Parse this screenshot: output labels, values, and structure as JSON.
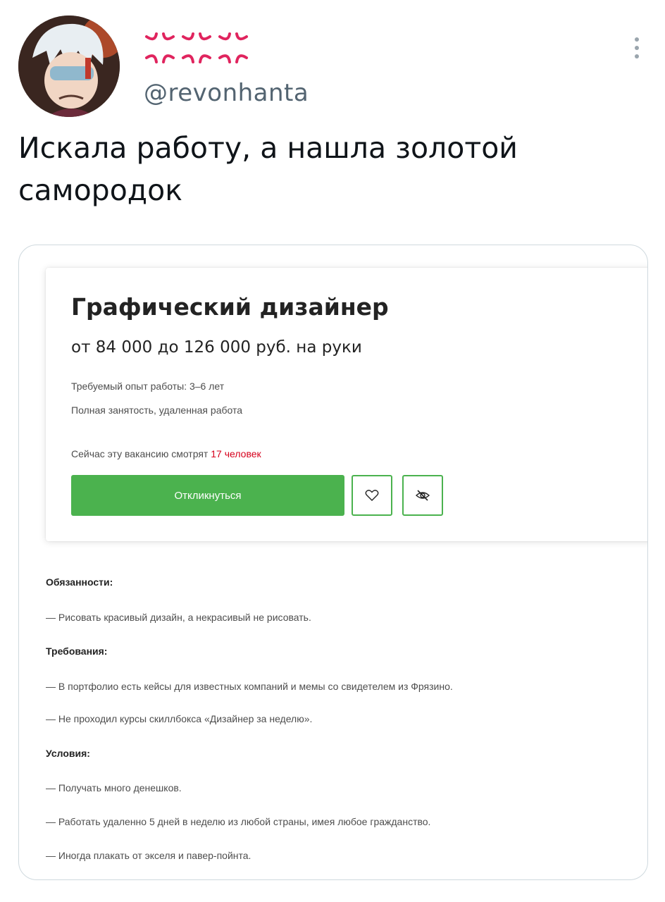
{
  "tweet": {
    "display_name_icons": [
      "anger-icon",
      "anger-icon",
      "anger-icon"
    ],
    "handle": "@revonhanta",
    "text": "Искала работу, а нашла золотой самородок"
  },
  "vacancy": {
    "title": "Графический дизайнер",
    "salary": "от 84 000 до 126 000 руб. на руки",
    "experience": "Требуемый опыт работы: 3–6 лет",
    "employment": "Полная занятость, удаленная работа",
    "viewers_prefix": "Сейчас эту вакансию смотрят ",
    "viewers_count": "17 человек",
    "apply_label": "Откликнуться",
    "accent_color": "#4bb24e"
  },
  "description": {
    "duties_heading": "Обязанности:",
    "duties": [
      "— Рисовать красивый дизайн, а некрасивый не рисовать."
    ],
    "requirements_heading": "Требования:",
    "requirements": [
      "— В портфолио есть кейсы для известных компаний и мемы со свидетелем из Фрязино.",
      "— Не проходил курсы скиллбокса «Дизайнер за неделю»."
    ],
    "conditions_heading": "Условия:",
    "conditions": [
      "— Получать много денешков.",
      "— Работать удаленно 5 дней в неделю из любой страны, имея любое гражданство.",
      "— Иногда плакать от экселя и павер-пойнта."
    ]
  }
}
